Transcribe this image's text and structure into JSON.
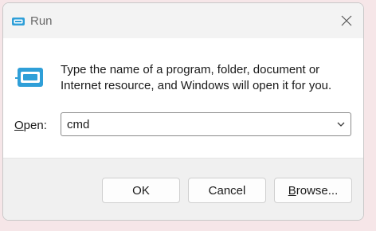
{
  "window": {
    "title": "Run",
    "title_icon": "run-icon",
    "close_icon": "close-icon"
  },
  "dialog": {
    "icon": "run-icon",
    "description": "Type the name of a program, folder, document or Internet resource, and Windows will open it for you.",
    "open_label_mnemonic": "O",
    "open_label_rest": "pen:",
    "open_value": "cmd",
    "dropdown_icon": "chevron-down-icon"
  },
  "buttons": {
    "ok_label": "OK",
    "cancel_label": "Cancel",
    "browse_mnemonic": "B",
    "browse_rest": "rowse..."
  },
  "colors": {
    "accent_icon": "#2f9fd8",
    "background": "#f6e6e8"
  }
}
